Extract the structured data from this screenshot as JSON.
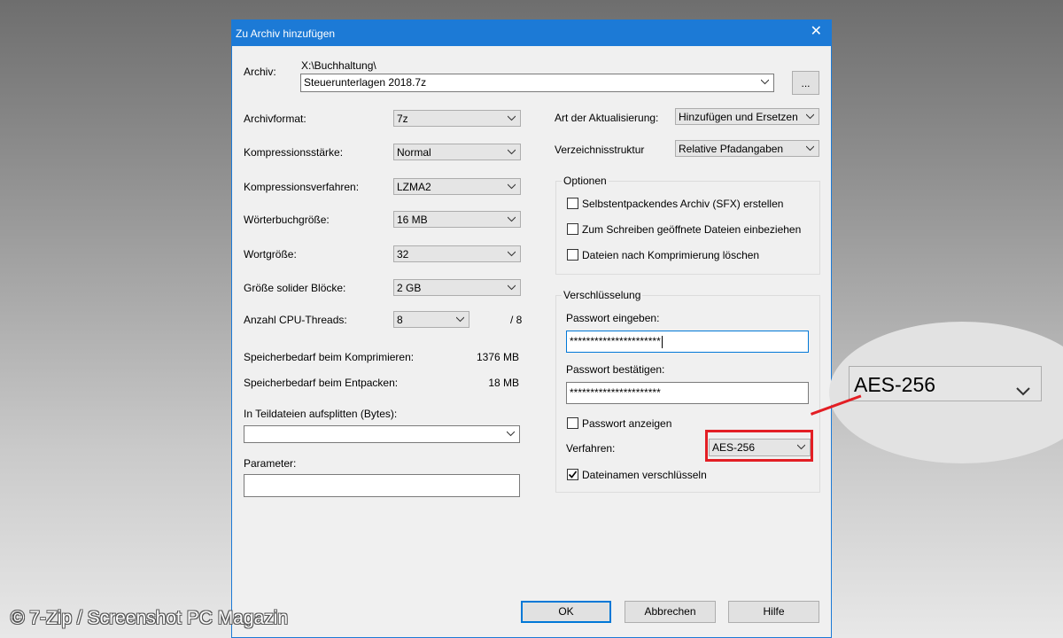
{
  "window": {
    "title": "Zu Archiv hinzufügen",
    "close_glyph": "✕"
  },
  "archive": {
    "label": "Archiv:",
    "path": "X:\\Buchhaltung\\",
    "filename": "Steuerunterlagen 2018.7z",
    "browse_label": "..."
  },
  "left_settings": [
    {
      "label": "Archivformat:",
      "value": "7z"
    },
    {
      "label": "Kompressionsstärke:",
      "value": "Normal"
    },
    {
      "label": "Kompressionsverfahren:",
      "value": "LZMA2"
    },
    {
      "label": "Wörterbuchgröße:",
      "value": "16 MB"
    },
    {
      "label": "Wortgröße:",
      "value": "32"
    },
    {
      "label": "Größe solider Blöcke:",
      "value": "2 GB"
    },
    {
      "label": "Anzahl CPU-Threads:",
      "value": "8"
    }
  ],
  "cpu_threads_max": "/ 8",
  "memory": {
    "compress_label": "Speicherbedarf beim Komprimieren:",
    "compress_value": "1376 MB",
    "decompress_label": "Speicherbedarf beim Entpacken:",
    "decompress_value": "18 MB"
  },
  "split": {
    "label": "In Teildateien aufsplitten (Bytes):",
    "value": ""
  },
  "parameter": {
    "label": "Parameter:",
    "value": ""
  },
  "update": {
    "label": "Art der Aktualisierung:",
    "value": "Hinzufügen und Ersetzen"
  },
  "path_mode": {
    "label": "Verzeichnisstruktur",
    "value": "Relative Pfadangaben"
  },
  "options": {
    "title": "Optionen",
    "items": [
      {
        "label": "Selbstentpackendes Archiv (SFX) erstellen",
        "checked": false
      },
      {
        "label": "Zum Schreiben geöffnete Dateien einbeziehen",
        "checked": false
      },
      {
        "label": "Dateien nach Komprimierung löschen",
        "checked": false
      }
    ]
  },
  "encryption": {
    "title": "Verschlüsselung",
    "password_label": "Passwort eingeben:",
    "password_value": "**********************",
    "confirm_label": "Passwort bestätigen:",
    "confirm_value": "**********************",
    "show_password_label": "Passwort anzeigen",
    "show_password_checked": false,
    "method_label": "Verfahren:",
    "method_value": "AES-256",
    "encrypt_names_label": "Dateinamen verschlüsseln",
    "encrypt_names_checked": true
  },
  "buttons": {
    "ok": "OK",
    "cancel": "Abbrechen",
    "help": "Hilfe"
  },
  "zoom_callout": {
    "value": "AES-256"
  },
  "watermark": "© 7-Zip / Screenshot PC Magazin",
  "colors": {
    "titlebar": "#1c7ad6",
    "highlight": "#e31e24"
  }
}
